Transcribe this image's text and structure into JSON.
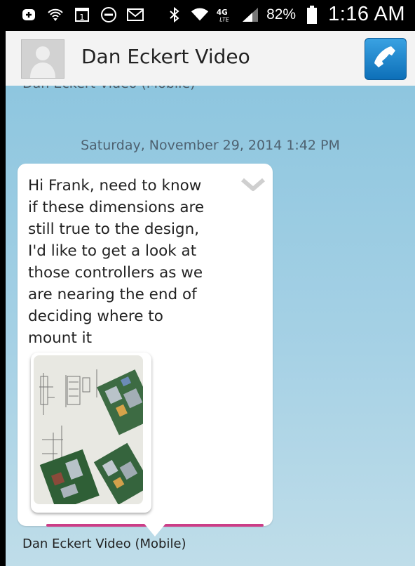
{
  "status_bar": {
    "battery_percent": "82%",
    "time": "1:16 AM",
    "icons": [
      "add-box-icon",
      "wifi-calling-icon",
      "calendar-icon",
      "do-not-disturb-icon",
      "gmail-icon",
      "bluetooth-icon",
      "wifi-icon",
      "lte-4g-icon",
      "cell-signal-icon",
      "battery-icon"
    ]
  },
  "header": {
    "contact_name": "Dan Eckert Video",
    "call_icon": "phone-icon"
  },
  "conversation": {
    "cut_off_label": "Dan Eckert Video (Mobile)",
    "date_separator": "Saturday, November 29, 2014 1:42 PM",
    "message": {
      "text": "Hi Frank, need to know\nif these dimensions are\nstill true to the design,\nI'd like to get a look at\nthose controllers as we\nare nearing the end of\ndeciding where to\nmount it",
      "attachment": "image-attachment",
      "sender_label": "Dan Eckert Video (Mobile)"
    }
  },
  "colors": {
    "header_bg": "#f3f3f3",
    "conversation_bg": "#8ec6df",
    "bubble_accent": "#cc3d87",
    "call_button": "#1c86cf"
  }
}
